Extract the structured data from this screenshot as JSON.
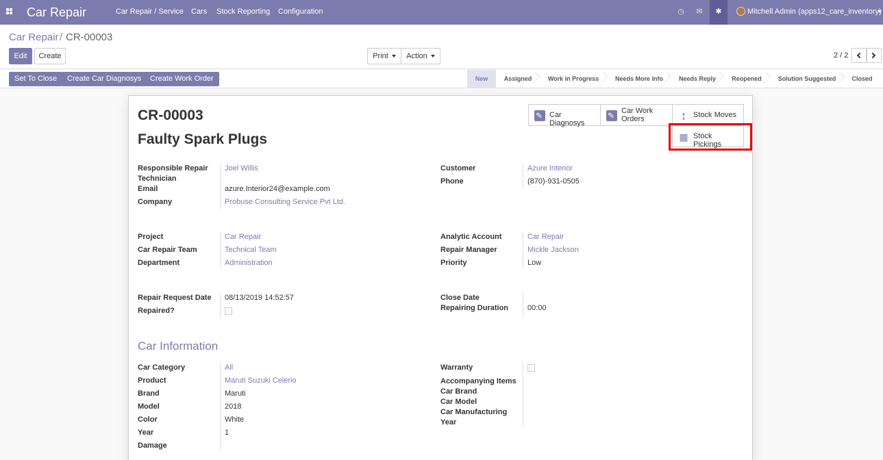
{
  "topbar": {
    "app_title": "Car Repair",
    "menu": [
      "Car Repair / Service",
      "Cars",
      "Stock Reporting",
      "Configuration"
    ],
    "user_name": "Mitchell Admin (apps12_care_inventory)"
  },
  "breadcrumb": {
    "parent": "Car Repair",
    "separator": "/",
    "current": "CR-00003"
  },
  "toolbar": {
    "edit": "Edit",
    "create": "Create",
    "print": "Print",
    "action": "Action",
    "pager": "2 / 2"
  },
  "statusbar": {
    "buttons": [
      "Set To Close",
      "Create Car Diagnosys",
      "Create Work Order"
    ],
    "stages": [
      "New",
      "Assigned",
      "Work in Progress",
      "Needs More Info",
      "Needs Reply",
      "Reopened",
      "Solution Suggested",
      "Closed"
    ],
    "active_stage": "New"
  },
  "record": {
    "id": "CR-00003",
    "name": "Faulty Spark Plugs"
  },
  "smart_buttons": {
    "car_diagnosys": "Car Diagnosys",
    "car_work_orders": "Car Work Orders",
    "stock_moves": "Stock Moves",
    "stock_pickings": "Stock Pickings"
  },
  "fields": {
    "technician_label": "Responsible Repair Technician",
    "technician": "Joel Willis",
    "email_label": "Email",
    "email": "azure.Interior24@example.com",
    "company_label": "Company",
    "company": "Probuse Consulting Service Pvt Ltd.",
    "customer_label": "Customer",
    "customer": "Azure Interior",
    "phone_label": "Phone",
    "phone": "(870)-931-0505",
    "project_label": "Project",
    "project": "Car Repair",
    "team_label": "Car Repair Team",
    "team": "Technical Team",
    "department_label": "Department",
    "department": "Administration",
    "analytic_label": "Analytic Account",
    "analytic": "Car Repair",
    "manager_label": "Repair Manager",
    "manager": "Mickle Jackson",
    "priority_label": "Priority",
    "priority": "Low",
    "request_date_label": "Repair Request Date",
    "request_date": "08/13/2019 14:52:57",
    "repaired_label": "Repaired?",
    "close_date_label": "Close Date",
    "duration_label": "Repairing Duration",
    "duration": "00:00"
  },
  "car_info": {
    "title": "Car Information",
    "category_label": "Car Category",
    "category": "All",
    "product_label": "Product",
    "product": "Maruti Suzuki Celerio",
    "brand_label": "Brand",
    "brand": "Maruti",
    "model_label": "Model",
    "model": "2018",
    "color_label": "Color",
    "color": "White",
    "year_label": "Year",
    "year": "1",
    "damage_label": "Damage",
    "warranty_label": "Warranty",
    "accompanying_label": "Accompanying Items",
    "car_brand_label": "Car Brand",
    "car_model_label": "Car Model",
    "car_mfg_year_label": "Car Manufacturing Year"
  },
  "colors": {
    "primary": "#7c7bad",
    "highlight": "#e60000"
  }
}
